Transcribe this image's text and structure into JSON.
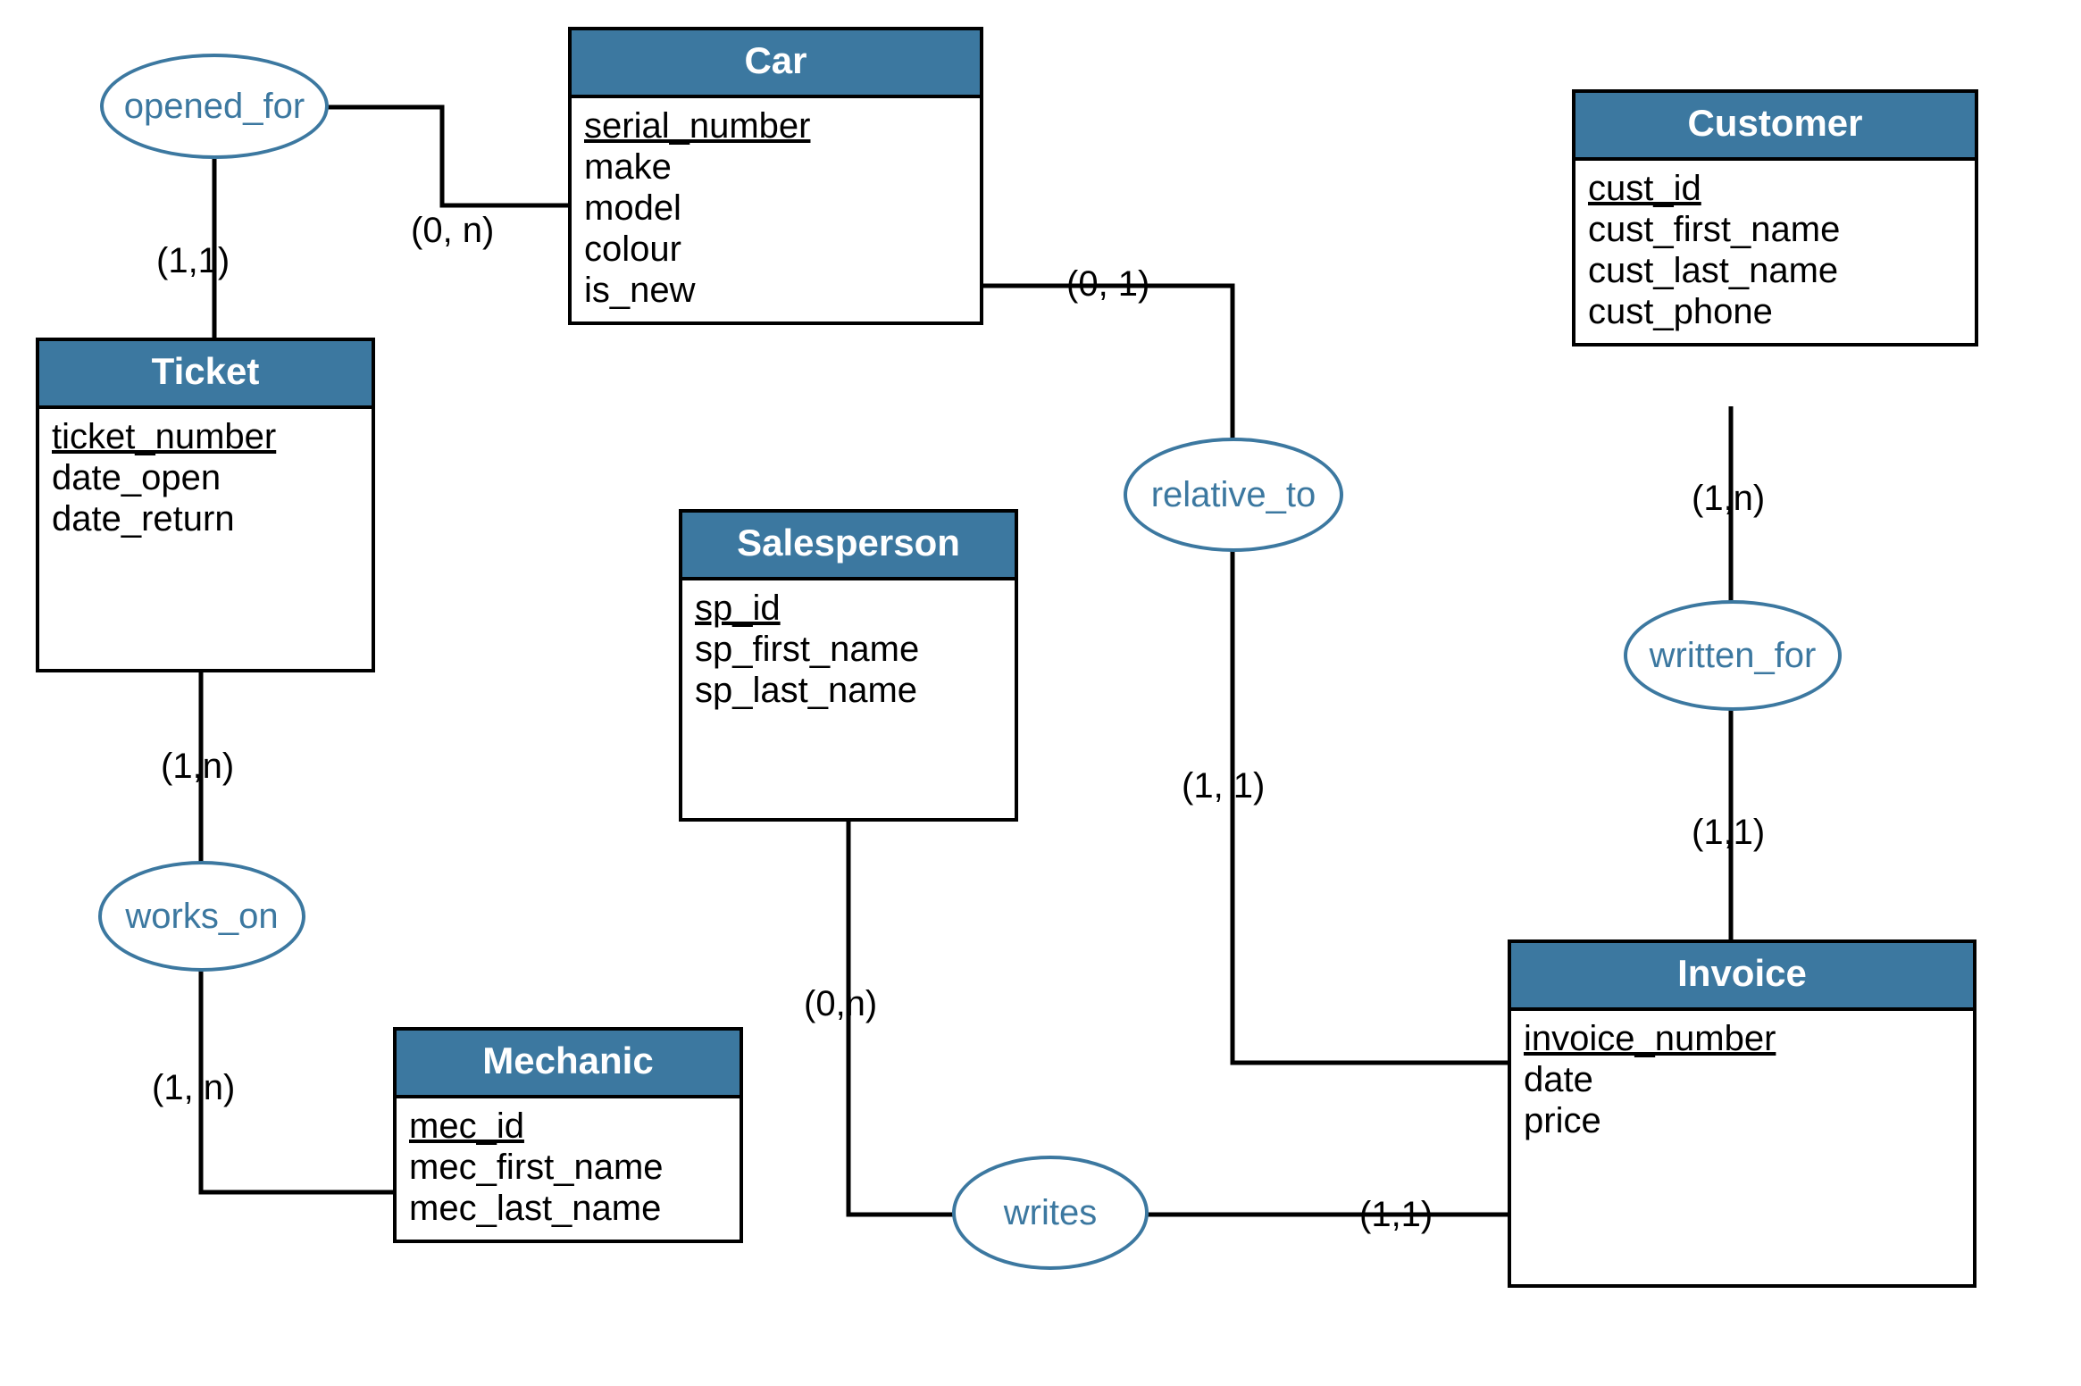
{
  "entities": {
    "car": {
      "title": "Car",
      "attrs": [
        "serial_number",
        "make",
        "model",
        "colour",
        "is_new"
      ],
      "keys": [
        "serial_number"
      ]
    },
    "customer": {
      "title": "Customer",
      "attrs": [
        "cust_id",
        "cust_first_name",
        "cust_last_name",
        "cust_phone"
      ],
      "keys": [
        "cust_id"
      ]
    },
    "ticket": {
      "title": "Ticket",
      "attrs": [
        "ticket_number",
        "date_open",
        "date_return"
      ],
      "keys": [
        "ticket_number"
      ]
    },
    "salesperson": {
      "title": "Salesperson",
      "attrs": [
        "sp_id",
        "sp_first_name",
        "sp_last_name"
      ],
      "keys": [
        "sp_id"
      ]
    },
    "mechanic": {
      "title": "Mechanic",
      "attrs": [
        "mec_id",
        "mec_first_name",
        "mec_last_name"
      ],
      "keys": [
        "mec_id"
      ]
    },
    "invoice": {
      "title": "Invoice",
      "attrs": [
        "invoice_number",
        "date",
        "price"
      ],
      "keys": [
        "invoice_number"
      ]
    }
  },
  "relationships": {
    "opened_for": {
      "label": "opened_for"
    },
    "relative_to": {
      "label": "relative_to"
    },
    "written_for": {
      "label": "written_for"
    },
    "works_on": {
      "label": "works_on"
    },
    "writes": {
      "label": "writes"
    }
  },
  "cardinalities": {
    "opened_for_ticket": "(1,1)",
    "opened_for_car": "(0, n)",
    "relative_to_car": "(0, 1)",
    "relative_to_invoice": "(1, 1)",
    "written_for_customer": "(1,n)",
    "written_for_invoice": "(1,1)",
    "works_on_ticket": "(1,n)",
    "works_on_mechanic": "(1, n)",
    "writes_salesperson": "(0,n)",
    "writes_invoice": "(1,1)"
  }
}
